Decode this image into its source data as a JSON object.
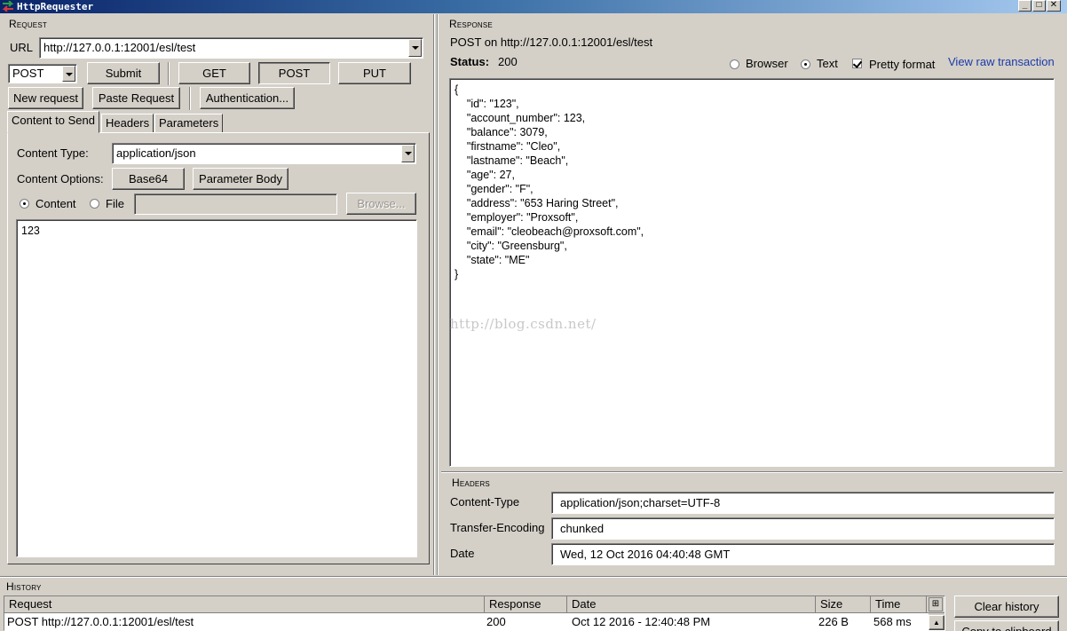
{
  "window": {
    "title": "HttpRequester"
  },
  "request": {
    "section_title": "Request",
    "url_label": "URL",
    "url_value": "http://127.0.0.1:12001/esl/test",
    "method_selected": "POST",
    "submit_label": "Submit",
    "get_label": "GET",
    "post_label": "POST",
    "put_label": "PUT",
    "new_request_label": "New request",
    "paste_request_label": "Paste Request",
    "authentication_label": "Authentication...",
    "tabs": [
      {
        "label": "Content to Send"
      },
      {
        "label": "Headers"
      },
      {
        "label": "Parameters"
      }
    ],
    "content_type_label": "Content Type:",
    "content_type_value": "application/json",
    "content_options_label": "Content Options:",
    "base64_label": "Base64",
    "parameter_body_label": "Parameter Body",
    "content_radio_label": "Content",
    "file_radio_label": "File",
    "file_path_value": "",
    "browse_label": "Browse...",
    "body_text": "123"
  },
  "response": {
    "section_title": "Response",
    "summary": "POST on http://127.0.0.1:12001/esl/test",
    "status_label": "Status:",
    "status_value": "200",
    "browser_label": "Browser",
    "text_label": "Text",
    "pretty_format_label": "Pretty format",
    "view_raw_label": "View raw transaction",
    "body_lines": [
      "{",
      "    \"id\": \"123\",",
      "    \"account_number\": 123,",
      "    \"balance\": 3079,",
      "    \"firstname\": \"Cleo\",",
      "    \"lastname\": \"Beach\",",
      "    \"age\": 27,",
      "    \"gender\": \"F\",",
      "    \"address\": \"653 Haring Street\",",
      "    \"employer\": \"Proxsoft\",",
      "    \"email\": \"cleobeach@proxsoft.com\",",
      "    \"city\": \"Greensburg\",",
      "    \"state\": \"ME\"",
      "}"
    ],
    "watermark": "http://blog.csdn.net/"
  },
  "headers": {
    "section_title": "Headers",
    "rows": [
      {
        "name": "Content-Type",
        "value": "application/json;charset=UTF-8"
      },
      {
        "name": "Transfer-Encoding",
        "value": "chunked"
      },
      {
        "name": "Date",
        "value": "Wed, 12 Oct 2016 04:40:48 GMT"
      }
    ]
  },
  "history": {
    "section_title": "History",
    "columns": {
      "request": "Request",
      "response": "Response",
      "date": "Date",
      "size": "Size",
      "time": "Time"
    },
    "rows": [
      {
        "request": "POST http://127.0.0.1:12001/esl/test",
        "response": "200",
        "date": "Oct 12 2016 - 12:40:48 PM",
        "size": "226 B",
        "time": "568 ms"
      }
    ],
    "clear_label": "Clear history",
    "copy_label": "Copy to clipboard"
  },
  "colors": {
    "link": "#1c3aa9",
    "titlebar": "#0a246a",
    "face": "#d4d0c8"
  }
}
